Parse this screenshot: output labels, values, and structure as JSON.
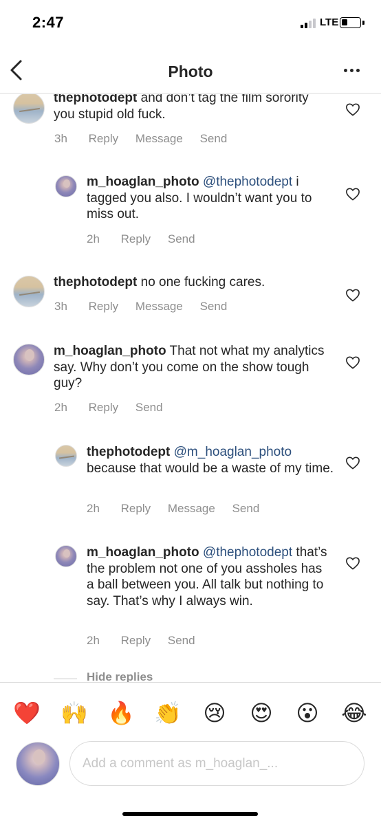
{
  "status_bar": {
    "time": "2:47",
    "network": "LTE",
    "battery_level": 0.35
  },
  "header": {
    "title": "Photo"
  },
  "comments": [
    {
      "username": "thephotodept",
      "mention": "",
      "text": " and don’t tag the film sorority you stupid old fuck.",
      "time": "3h",
      "actions": [
        "Reply",
        "Message",
        "Send"
      ]
    },
    {
      "username": "m_hoaglan_photo",
      "mention": " @thephotodept",
      "text": " i tagged you also. I wouldn’t want you to miss out.",
      "time": "2h",
      "actions": [
        "Reply",
        "Send"
      ]
    },
    {
      "username": "thephotodept",
      "mention": "",
      "text": " no one fucking cares.",
      "time": "3h",
      "actions": [
        "Reply",
        "Message",
        "Send"
      ]
    },
    {
      "username": "m_hoaglan_photo",
      "mention": "",
      "text": " That not what my analytics say. Why don’t you come on the show tough guy?",
      "time": "2h",
      "actions": [
        "Reply",
        "Send"
      ]
    },
    {
      "username": "thephotodept",
      "mention": " @m_hoaglan_photo",
      "text": " because that would be a waste of my time.",
      "time": "2h",
      "actions": [
        "Reply",
        "Message",
        "Send"
      ]
    },
    {
      "username": "m_hoaglan_photo",
      "mention": " @thephotodept",
      "text": " that’s the problem not one of you assholes has a ball between you. All talk but nothing to say. That’s why I always win.",
      "time": "2h",
      "actions": [
        "Reply",
        "Send"
      ]
    }
  ],
  "hide_replies": "Hide replies",
  "emoji_bar": [
    "❤️",
    "🙌",
    "🔥",
    "👏",
    "😢",
    "😍",
    "😮",
    "😂"
  ],
  "composer": {
    "placeholder": "Add a comment as m_hoaglan_..."
  }
}
